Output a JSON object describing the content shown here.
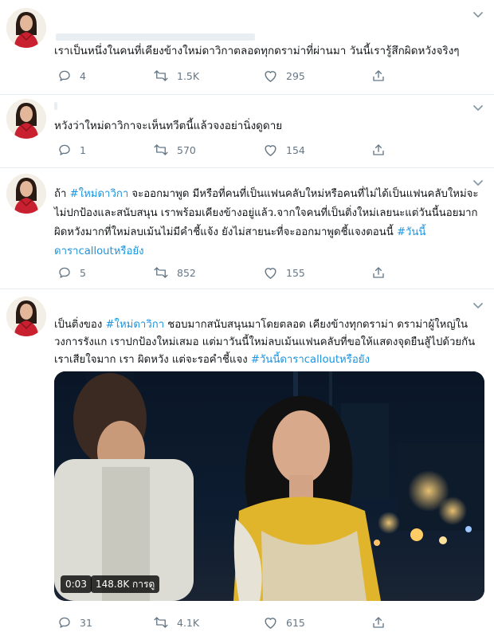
{
  "tweets": [
    {
      "text_parts": [
        "เราเป็นหนึ่งในคนที่เคียงข้างใหม่ดาวิกาตลอดทุกดราม่าที่ผ่านมา วันนี้เรารู้สึกผิดหวังจริงๆ"
      ],
      "replies": "4",
      "retweets": "1.5K",
      "likes": "295"
    },
    {
      "text_parts": [
        "หวังว่าใหม่ดาวิกาจะเห็นทวีตนี้แล้วจงอย่านิ่งดูดาย"
      ],
      "replies": "1",
      "retweets": "570",
      "likes": "154"
    },
    {
      "text_parts": [
        "ถ้า ",
        "#ใหม่ดาวิกา",
        " จะออกมาพูด มีหรือที่คนที่เป็นแฟนคลับใหม่หรือคนที่ไม่ได้เป็นแฟนคลับใหม่จะไม่ปกป้องและสนับสนุน เราพร้อมเคียงข้างอยู่แล้ว.จากใจคนที่เป็นติ่งใหม่เลยนะแต่วันนี้นอยมากผิดหวังมากที่ใหม่ลบเม้นไม่มีคำชี้แจ้ง ยังไม่สายนะที่จะออกมาพูดชี้แจงตอนนี้ ",
        "#วันนี้ดาราcalloutหรือยัง"
      ],
      "replies": "5",
      "retweets": "852",
      "likes": "155"
    },
    {
      "text_parts": [
        "เป็นติ่งของ ",
        "#ใหม่ดาวิกา",
        " ชอบมากสนับสนุนมาโดยตลอด เคียงข้างทุกดราม่า ดราม่าผู้ใหญ่ในวงการรังแก เราปกป้องใหม่เสมอ แต่มาวันนี้ใหม่ลบเม้นแฟนคลับที่ขอให้แสดงจุดยืนสู้ไปด้วยกัน เราเสียใจมาก เรา ผิดหวัง แต่จะรอคำชี้แจง ",
        "#วันนี้ดาราcalloutหรือยัง"
      ],
      "replies": "31",
      "retweets": "4.1K",
      "likes": "615"
    }
  ],
  "video": {
    "time": "0:03",
    "views": "148.8K การดู"
  },
  "colors": {
    "hashtag": "#1b95e0",
    "action_gray": "#657786",
    "divider": "#e6ecf0"
  },
  "icons": [
    "avatar",
    "chevron-down-icon",
    "reply-icon",
    "retweet-icon",
    "like-icon",
    "share-icon"
  ]
}
